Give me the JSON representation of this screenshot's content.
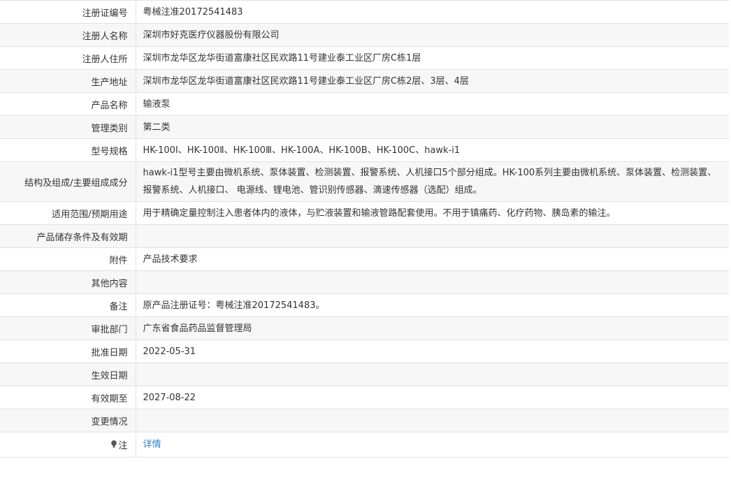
{
  "rows": [
    {
      "label": "注册证编号",
      "value": "粤械注准20172541483"
    },
    {
      "label": "注册人名称",
      "value": "深圳市好克医疗仪器股份有限公司"
    },
    {
      "label": "注册人住所",
      "value": "深圳市龙华区龙华街道富康社区民欢路11号建业泰工业区厂房C栋1层"
    },
    {
      "label": "生产地址",
      "value": "深圳市龙华区龙华街道富康社区民欢路11号建业泰工业区厂房C栋2层、3层、4层"
    },
    {
      "label": "产品名称",
      "value": "输液泵"
    },
    {
      "label": "管理类别",
      "value": "第二类"
    },
    {
      "label": "型号规格",
      "value": "HK-100Ⅰ、HK-100Ⅱ、HK-100Ⅲ、HK-100A、HK-100B、HK-100C、hawk-i1"
    },
    {
      "label": "结构及组成/主要组成成分",
      "value": "hawk-i1型号主要由微机系统、泵体装置、检测装置、报警系统、人机接口5个部分组成。HK-100系列主要由微机系统、泵体装置、检测装置、报警系统、人机接口、 电源线、锂电池、管识别传感器、滴速传感器（选配）组成。"
    },
    {
      "label": "适用范围/预期用途",
      "value": "用于精确定量控制注入患者体内的液体，与贮液装置和输液管路配套使用。不用于镇痛药、化疗药物、胰岛素的输注。"
    },
    {
      "label": "产品储存条件及有效期",
      "value": ""
    },
    {
      "label": "附件",
      "value": "产品技术要求"
    },
    {
      "label": "其他内容",
      "value": ""
    },
    {
      "label": "备注",
      "value": "原产品注册证号：粤械注准20172541483。"
    },
    {
      "label": "审批部门",
      "value": "广东省食品药品监督管理局"
    },
    {
      "label": "批准日期",
      "value": "2022-05-31"
    },
    {
      "label": "生效日期",
      "value": ""
    },
    {
      "label": "有效期至",
      "value": "2027-08-22"
    },
    {
      "label": "变更情况",
      "value": ""
    }
  ],
  "note": {
    "label": "注",
    "icon": "lightbulb-icon",
    "link_text": "详情",
    "link_color": "#2f7fc9"
  }
}
